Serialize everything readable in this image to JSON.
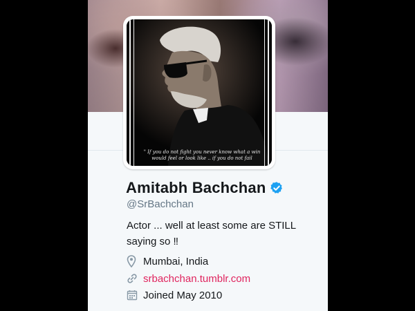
{
  "profile": {
    "name": "Amitabh Bachchan",
    "handle": "@SrBachchan",
    "bio_line1": "Actor ... well at least some are STILL",
    "bio_line2": "saying so ‼",
    "location": "Mumbai, India",
    "website": "srbachchan.tumblr.com",
    "joined": "Joined May 2010",
    "verified": true,
    "avatar_caption_line1": "\" If you do not fight you never know what a win",
    "avatar_caption_line2": "would feel or look like .. if you do not fail"
  },
  "colors": {
    "verified_badge": "#1da1f2",
    "link": "#e0245e",
    "secondary_text": "#657786",
    "primary_text": "#14171a",
    "panel_bg": "#f5f8fa"
  },
  "icons": {
    "location": "map-pin-icon",
    "website": "link-icon",
    "joined": "calendar-icon",
    "verified": "verified-badge-icon"
  }
}
